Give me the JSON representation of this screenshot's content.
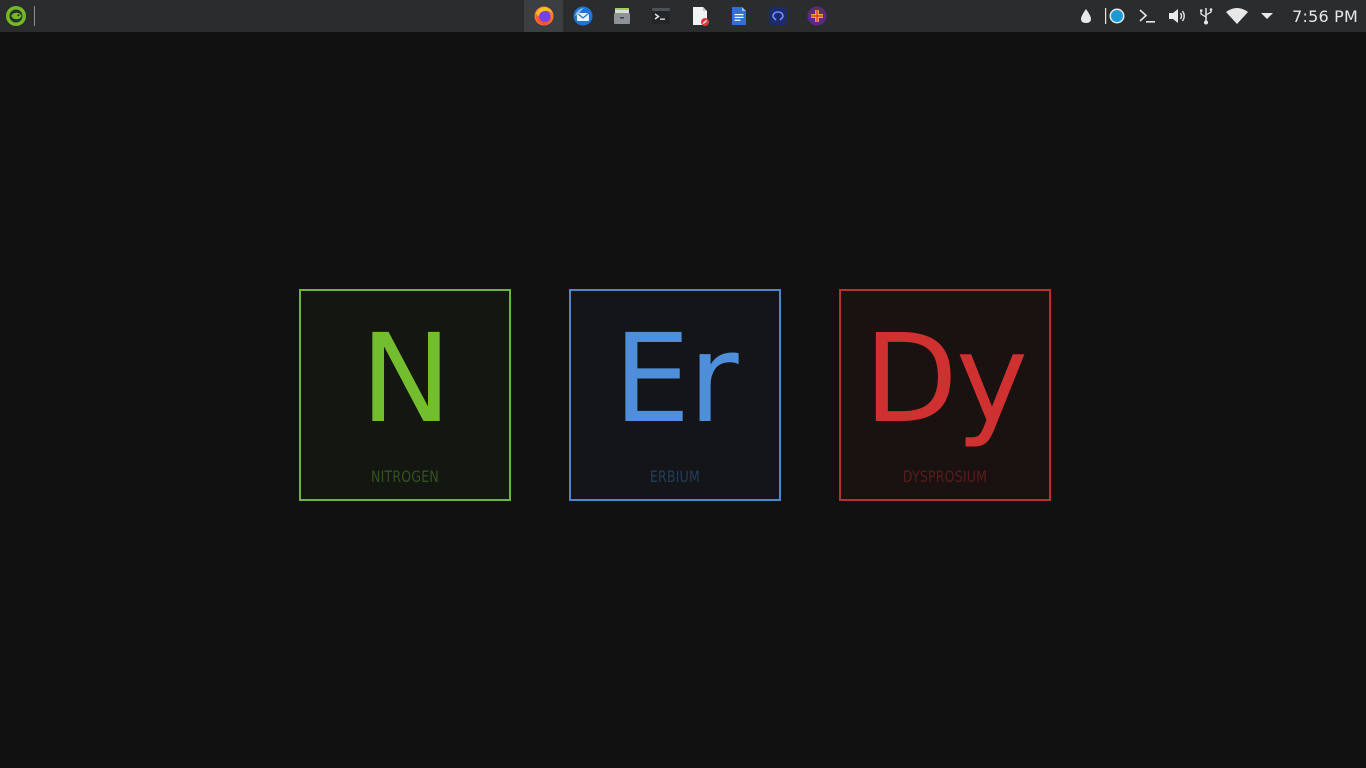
{
  "panel": {
    "launcher_icon": "opensuse-gecko-icon",
    "tasks": [
      {
        "icon": "firefox-icon",
        "active": true
      },
      {
        "icon": "thunderbird-icon",
        "active": false
      },
      {
        "icon": "file-manager-icon",
        "active": false
      },
      {
        "icon": "terminal-icon",
        "active": false
      },
      {
        "icon": "document-viewer-icon",
        "active": false
      },
      {
        "icon": "text-document-icon",
        "active": false
      },
      {
        "icon": "network-icon",
        "active": false
      },
      {
        "icon": "add-plus-icon",
        "active": false
      }
    ],
    "tray": [
      "droplet-icon",
      "color-picker-icon",
      "terminal-prompt-icon",
      "volume-icon",
      "usb-icon",
      "wifi-icon",
      "tray-expand-arrow-icon"
    ],
    "clock": "7:56 PM"
  },
  "desktop": {
    "elements": [
      {
        "symbol": "N",
        "name": "NITROGEN",
        "color": "#73be2e"
      },
      {
        "symbol": "Er",
        "name": "ERBIUM",
        "color": "#4f8ed9"
      },
      {
        "symbol": "Dy",
        "name": "DYSPROSIUM",
        "color": "#cf3030"
      }
    ]
  }
}
